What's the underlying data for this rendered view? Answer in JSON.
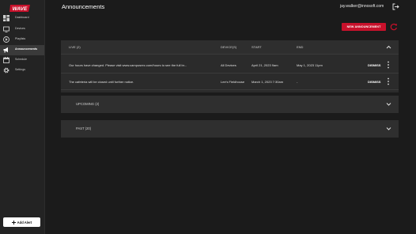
{
  "app": {
    "logo_text": "WAVE",
    "brand_color": "#c8112b"
  },
  "sidebar": {
    "items": [
      {
        "label": "Dashboard",
        "icon": "dashboard-icon"
      },
      {
        "label": "Devices",
        "icon": "monitor-icon"
      },
      {
        "label": "Playlists",
        "icon": "play-circle-icon"
      },
      {
        "label": "Announcements",
        "icon": "megaphone-icon",
        "active": true
      },
      {
        "label": "Schedule",
        "icon": "calendar-icon"
      },
      {
        "label": "Settings",
        "icon": "gear-icon"
      }
    ],
    "add_alert_label": "Add Alert"
  },
  "header": {
    "title": "Announcements",
    "user_email": "jay.walker@innosoft.com"
  },
  "toolbar": {
    "new_announcement_label": "NEW ANNOUNCEMENT"
  },
  "live": {
    "title": "LIVE (2)",
    "columns": {
      "devices": "DEVICE(S)",
      "start": "START",
      "end": "END"
    },
    "rows": [
      {
        "message": "Our hours have changed. Please visit www.campusrec.com/hours to see the full br...",
        "devices": "All Devices",
        "start": "April 21, 2023 9am",
        "end": "May 1, 2023 11pm",
        "action": "DISMISS"
      },
      {
        "message": "The cafeteria will be closed until further notice.",
        "devices": "Lee's Fieldhouse",
        "start": "March 1, 2023 7:30am",
        "end": "-",
        "action": "DISMISS"
      }
    ]
  },
  "upcoming": {
    "title": "UPCOMING (2)"
  },
  "past": {
    "title": "PAST (20)"
  }
}
